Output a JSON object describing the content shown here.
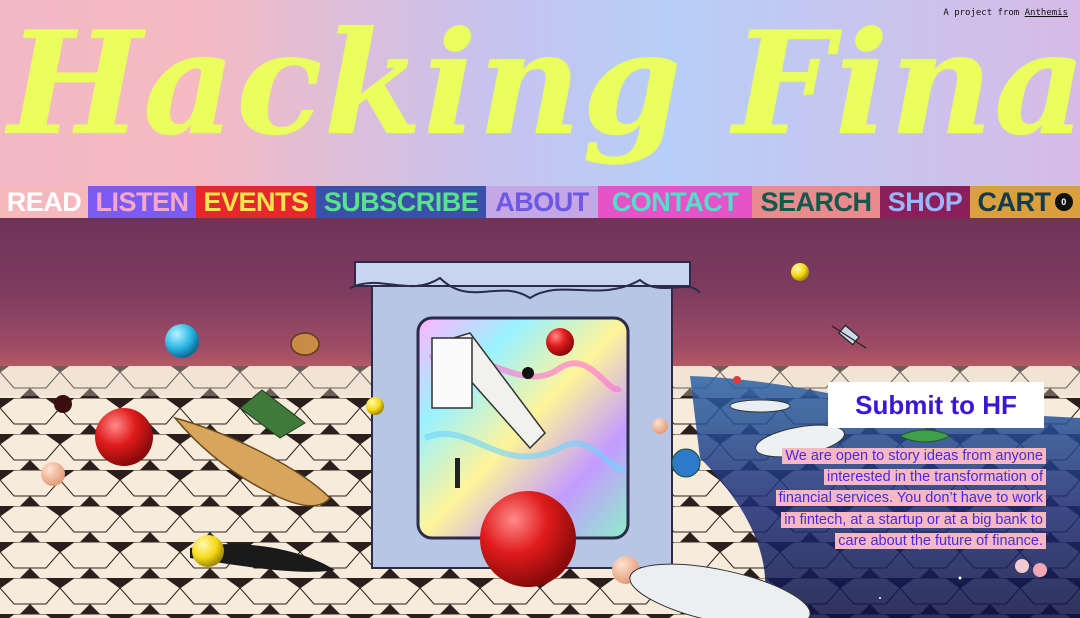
{
  "header": {
    "masthead": "Hacking Finance",
    "credit_prefix": "A project from",
    "credit_link": "Anthemis"
  },
  "nav": {
    "items": [
      {
        "label": "READ",
        "bg": "#f4b8bd",
        "fg": "#ffffff"
      },
      {
        "label": "LISTEN",
        "bg": "#7b5bf2",
        "fg": "#f6a7c8"
      },
      {
        "label": "EVENTS",
        "bg": "#e8262e",
        "fg": "#f5e44c"
      },
      {
        "label": "SUBSCRIBE",
        "bg": "#3b50a8",
        "fg": "#57e38a"
      },
      {
        "label": "ABOUT",
        "bg": "#c5a7e6",
        "fg": "#6c58e4"
      },
      {
        "label": "CONTACT",
        "bg": "#e653c8",
        "fg": "#51e0c9"
      },
      {
        "label": "SEARCH",
        "bg": "#e98a8f",
        "fg": "#12584b"
      },
      {
        "label": "SHOP",
        "bg": "#8a1f5b",
        "fg": "#9bb5ff"
      },
      {
        "label": "CART",
        "bg": "#d9a03c",
        "fg": "#123b4d"
      }
    ],
    "cart_count": "0"
  },
  "submit": {
    "title": "Submit to HF",
    "lines": [
      "We are open to story ideas from anyone",
      "interested in the transformation of",
      "financial services. You don’t have to work",
      "in fintech, at a startup or at a big bank to",
      "care about the future of finance."
    ]
  },
  "colors": {
    "masthead": "#eaff5e",
    "submit_accent": "#3b16d8",
    "highlight": "#f5b8c4"
  }
}
